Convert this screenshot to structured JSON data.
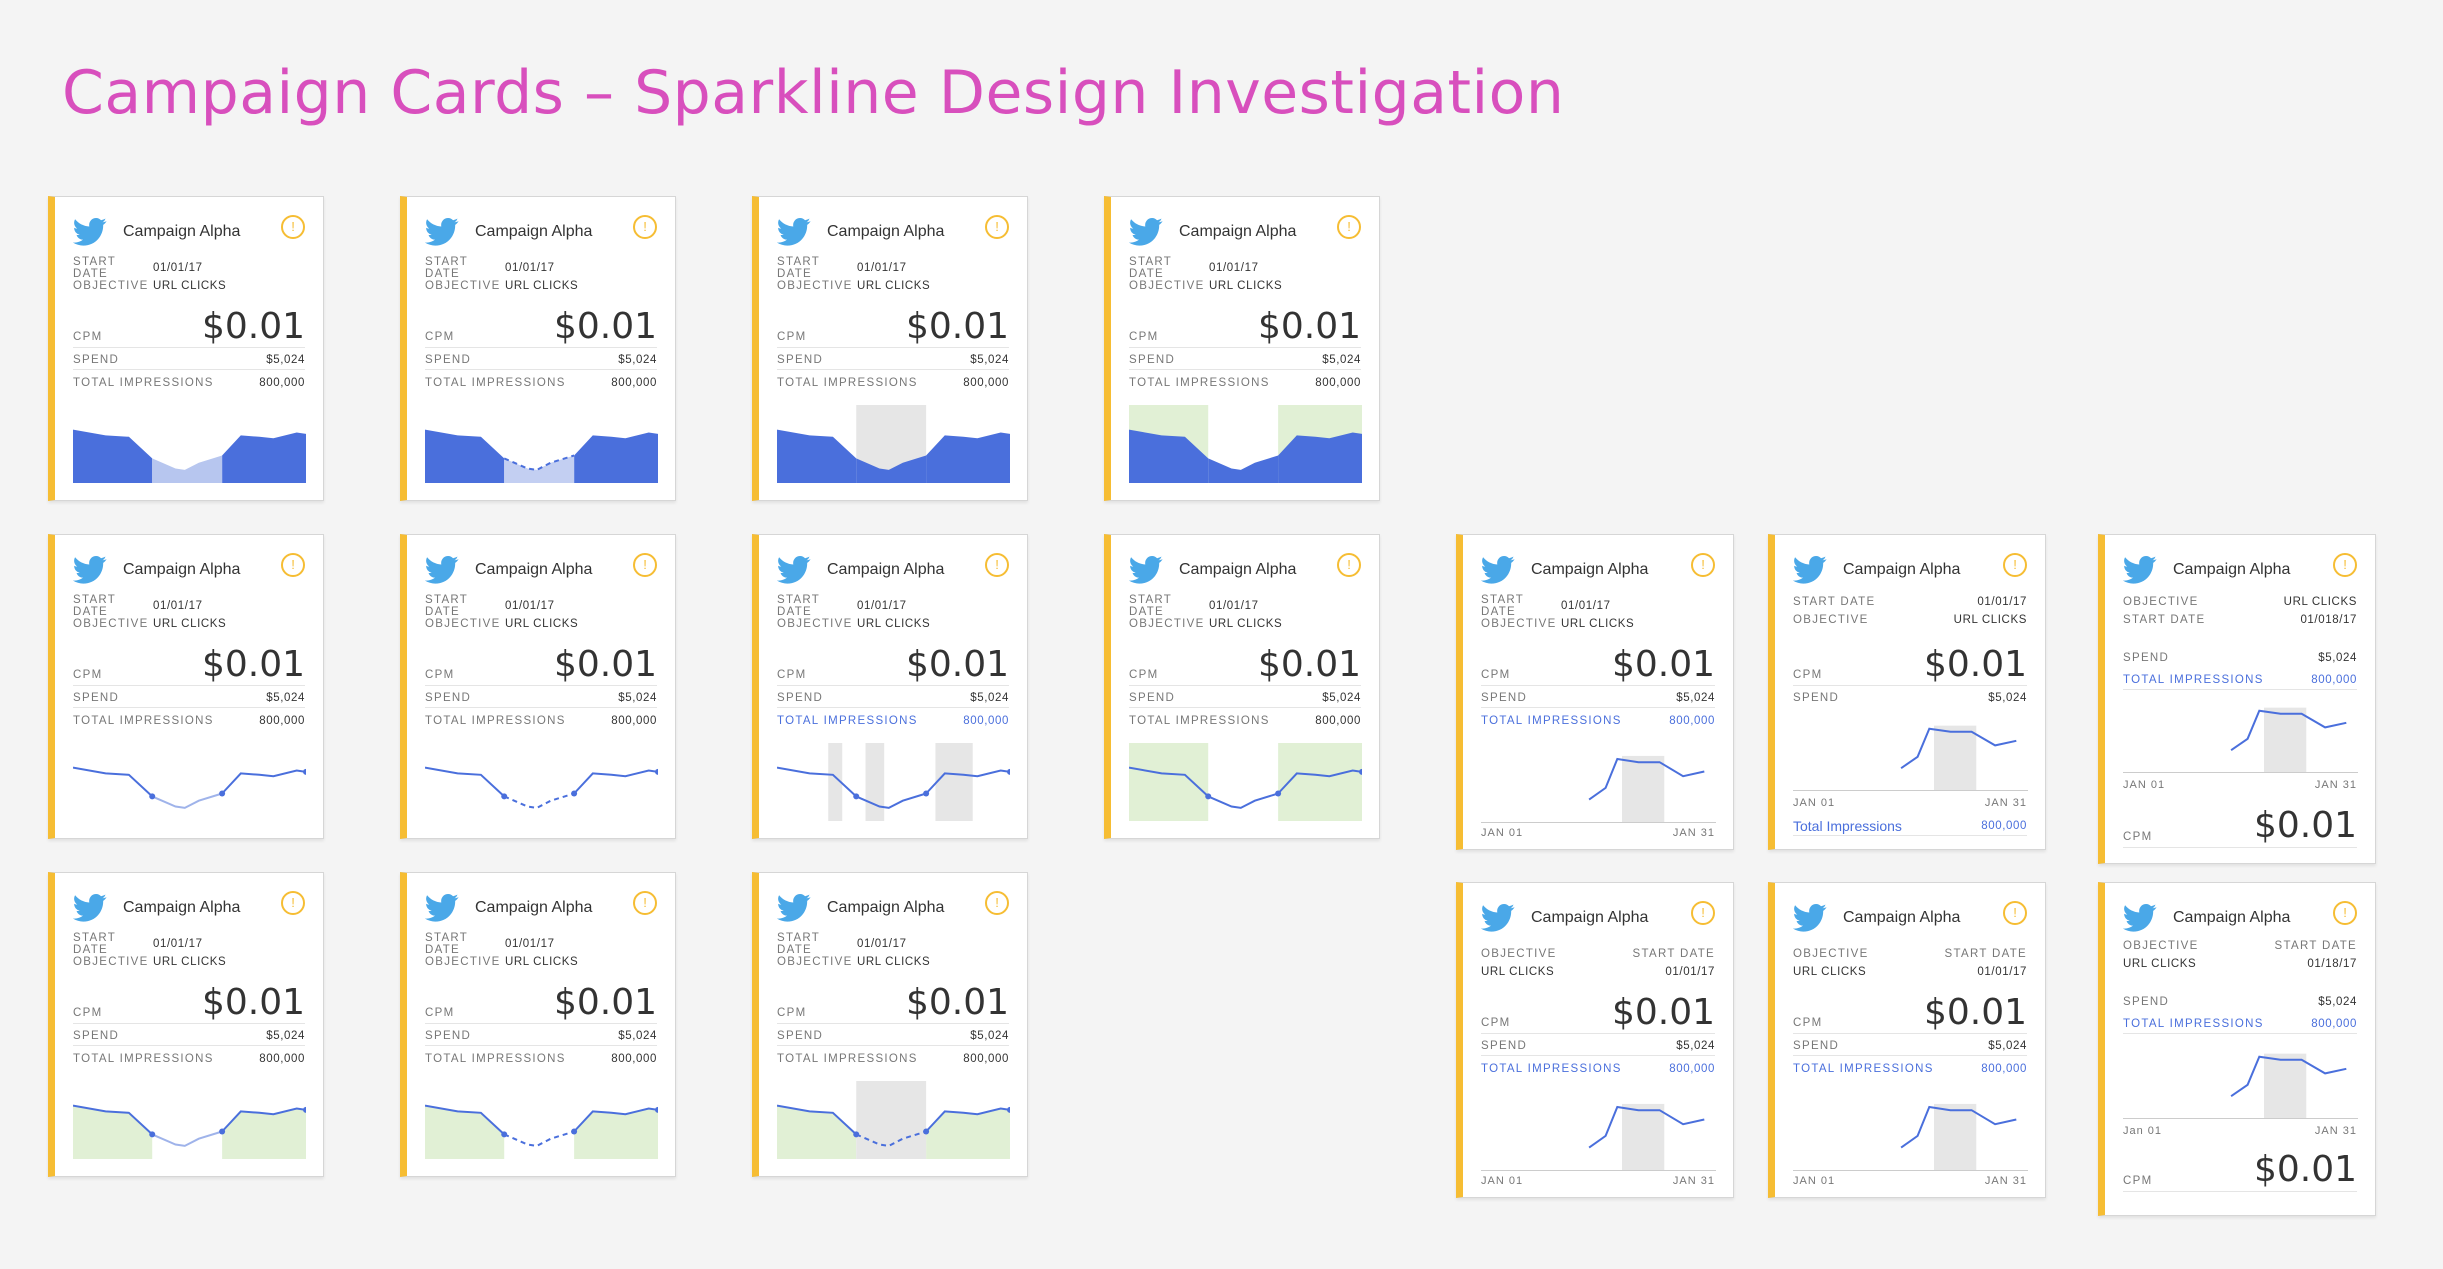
{
  "title": "Campaign Cards – Sparkline Design Investigation",
  "card": {
    "name": "Campaign Alpha",
    "alert": "!",
    "start_date_label": "START DATE",
    "start_date": "01/01/17",
    "start_date_alt": "01/018/17",
    "start_date_alt2": "01/18/17",
    "objective_label": "OBJECTIVE",
    "objective": "URL CLICKS",
    "cpm_label": "CPM",
    "cpm": "$0.01",
    "spend_label": "SPEND",
    "spend": "$5,024",
    "impressions_label": "TOTAL IMPRESSIONS",
    "impressions_label_title": "Total Impressions",
    "impressions": "800,000",
    "axis_start": "JAN 01",
    "axis_start_alt": "Jan 01",
    "axis_end": "JAN 31"
  },
  "colors": {
    "accent_bar": "#f6bd33",
    "title": "#d84fbd",
    "area_fill": "#4a6fdc",
    "line": "#4a6fdc",
    "highlight_green": "#e1f0d5",
    "highlight_gray": "#e6e6e6",
    "twitter": "#4aa8e8"
  },
  "icons": [
    "twitter-bird-icon",
    "alert-circle-icon"
  ]
}
